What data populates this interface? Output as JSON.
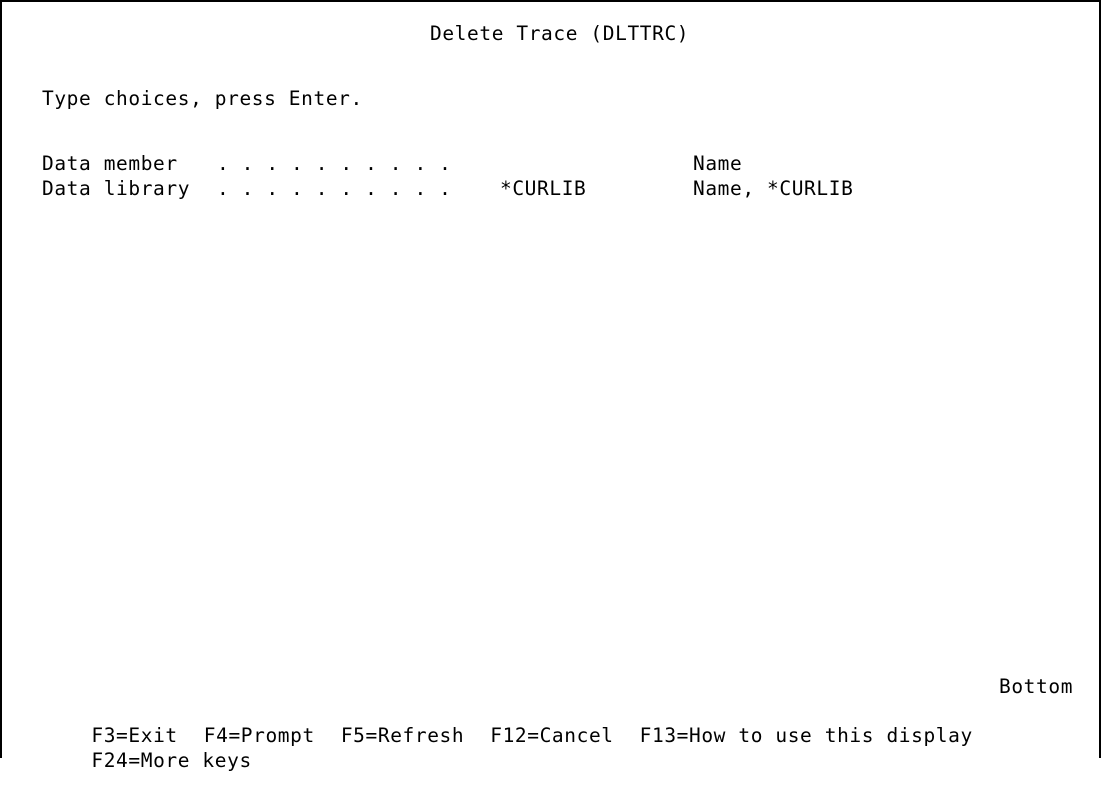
{
  "screen": {
    "title": "Delete Trace (DLTTRC)",
    "instructions": "Type choices, press Enter."
  },
  "fields": [
    {
      "label": "Data member",
      "dots": ". . . . . . . . . .",
      "value": "",
      "hint": "Name"
    },
    {
      "label": "Data library",
      "dots": ". . . . . . . . . .",
      "value": "*CURLIB",
      "hint": "Name, *CURLIB"
    }
  ],
  "status": {
    "more_indicator": "Bottom"
  },
  "function_keys": {
    "row1": [
      "F3=Exit",
      "F4=Prompt",
      "F5=Refresh",
      "F12=Cancel",
      "F13=How to use this display"
    ],
    "row2": [
      "F24=More keys"
    ]
  }
}
